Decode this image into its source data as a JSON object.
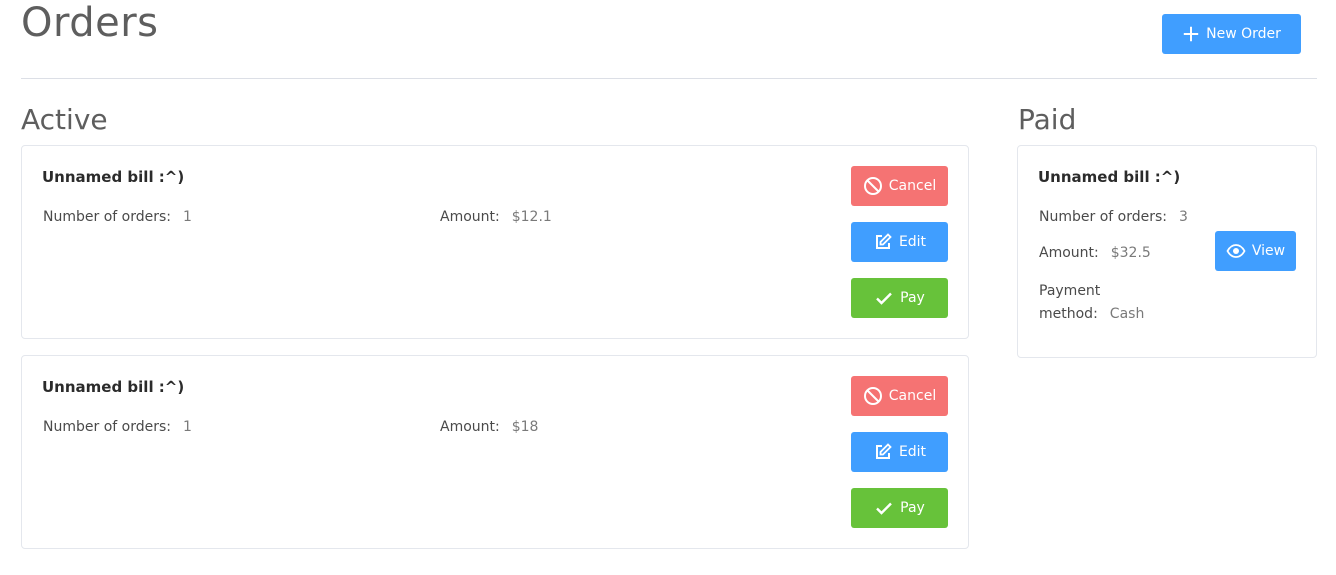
{
  "header": {
    "title": "Orders",
    "new_order_label": "New Order"
  },
  "sections": {
    "active_title": "Active",
    "paid_title": "Paid"
  },
  "active_orders": [
    {
      "name": "Unnamed bill :^)",
      "orders_label": "Number of orders:",
      "orders_count": "1",
      "amount_label": "Amount:",
      "amount": "$12.1",
      "cancel_label": "Cancel",
      "edit_label": "Edit",
      "pay_label": "Pay"
    },
    {
      "name": "Unnamed bill :^)",
      "orders_label": "Number of orders:",
      "orders_count": "1",
      "amount_label": "Amount:",
      "amount": "$18",
      "cancel_label": "Cancel",
      "edit_label": "Edit",
      "pay_label": "Pay"
    }
  ],
  "paid_orders": [
    {
      "name": "Unnamed bill :^)",
      "orders_label": "Number of orders:",
      "orders_count": "3",
      "amount_label": "Amount:",
      "amount": "$32.5",
      "payment_label_1": "Payment",
      "payment_label_2": "method:",
      "payment_method": "Cash",
      "view_label": "View"
    }
  ],
  "colors": {
    "primary": "#409eff",
    "danger": "#f56c6c",
    "success": "#67c23a",
    "divider": "#dcdfe6"
  },
  "icons": {
    "new_order": "plus-icon",
    "cancel": "ban-icon",
    "edit": "edit-icon",
    "pay": "check-icon",
    "view": "eye-icon"
  }
}
